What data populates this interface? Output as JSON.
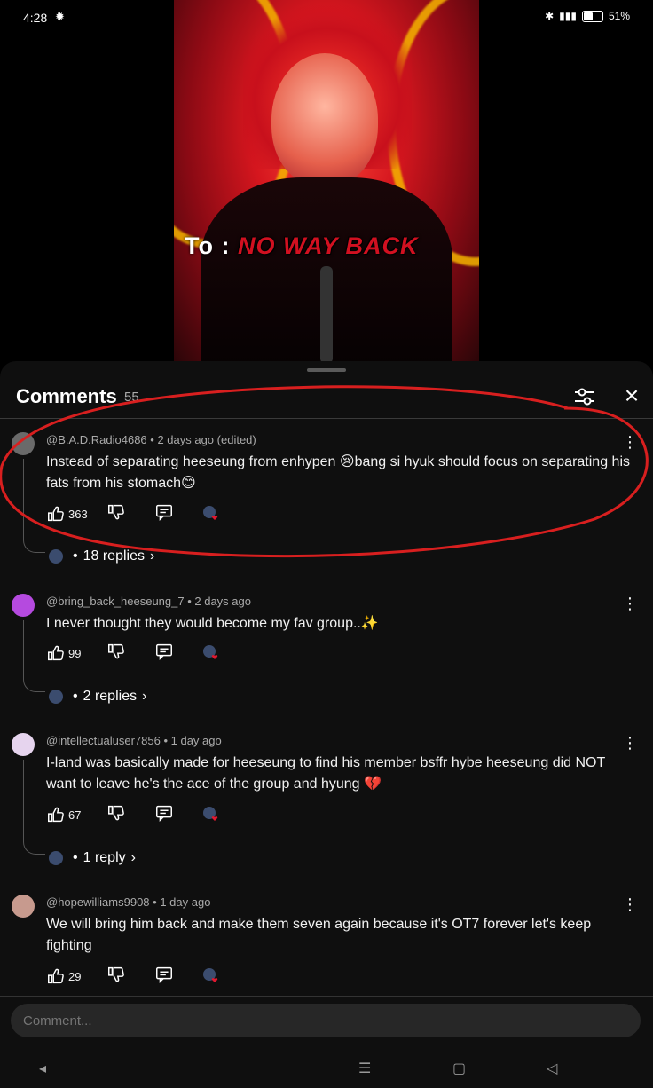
{
  "status": {
    "time": "4:28",
    "battery": "51%"
  },
  "video": {
    "caption_prefix": "To :",
    "caption_main": "NO WAY BACK"
  },
  "sheet": {
    "title": "Comments",
    "count": "55"
  },
  "comments": [
    {
      "author": "@B.A.D.Radio4686",
      "time": "2 days ago (edited)",
      "text": "Instead of separating heeseung from enhypen 😢bang si hyuk should focus on separating his fats from his stomach😊",
      "likes": "363",
      "replies": "18 replies",
      "avatar_color": "#6a6a6a"
    },
    {
      "author": "@bring_back_heeseung_7",
      "time": "2 days ago",
      "text": "I never thought they would become my fav group..✨",
      "likes": "99",
      "replies": "2 replies",
      "avatar_color": "#b54adf"
    },
    {
      "author": "@intellectualuser7856",
      "time": "1 day ago",
      "text": "I-land was basically made for heeseung to find his member bsffr hybe heeseung did NOT want to leave he's the ace of the group and hyung 💔",
      "likes": "67",
      "replies": "1 reply",
      "avatar_color": "#e6d4ee"
    },
    {
      "author": "@hopewilliams9908",
      "time": "1 day ago",
      "text": "We will bring him back and make them seven again because it's OT7 forever let's keep fighting",
      "likes": "29",
      "avatar_color": "#c79a8e"
    }
  ],
  "input": {
    "placeholder": "Comment..."
  },
  "colors": {
    "annotation": "#d81f1f",
    "sheet_bg": "#0f0f0f",
    "meta_text": "#aaaaaa"
  },
  "icons": [
    "settings-gear-icon",
    "bluetooth-icon",
    "signal-icon",
    "battery-icon",
    "filter-icon",
    "close-icon",
    "thumbs-up-icon",
    "thumbs-down-icon",
    "reply-icon",
    "more-vert-icon",
    "chevron-right-icon",
    "nav-back-icon",
    "nav-recents-icon",
    "nav-home-icon"
  ]
}
